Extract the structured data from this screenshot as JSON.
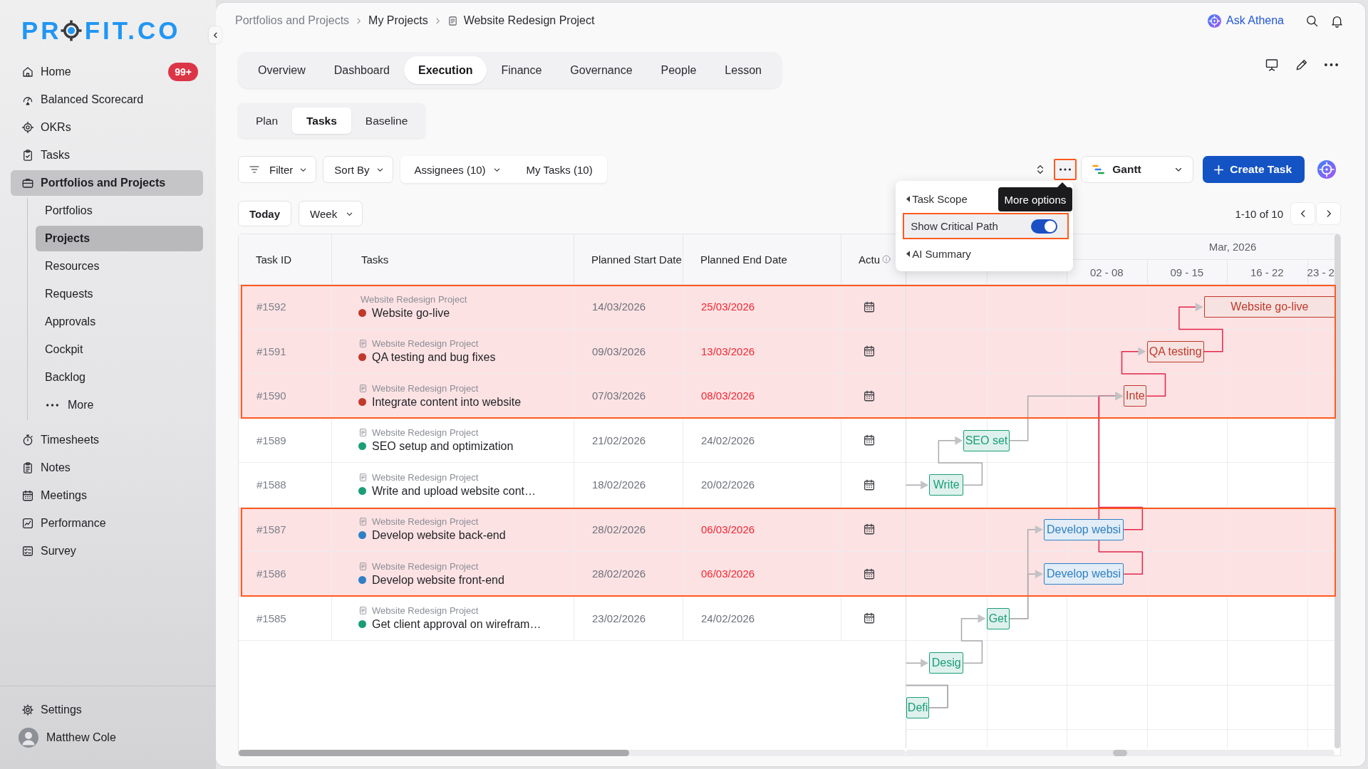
{
  "sidebar": {
    "logo": {
      "before": "PR",
      "after": "FIT.CO"
    },
    "items": [
      {
        "label": "Home",
        "badge": "99+",
        "selected": false
      },
      {
        "label": "Balanced Scorecard",
        "selected": false
      },
      {
        "label": "OKRs",
        "selected": false
      },
      {
        "label": "Tasks",
        "selected": false
      },
      {
        "label": "Portfolios and Projects",
        "selected": true,
        "children": [
          {
            "label": "Portfolios",
            "kind": "page",
            "selected": false
          },
          {
            "label": "Projects",
            "kind": "page",
            "selected": true
          },
          {
            "label": "Resources",
            "kind": "page",
            "selected": false
          },
          {
            "label": "Requests",
            "kind": "page",
            "selected": false
          },
          {
            "label": "Approvals",
            "kind": "page",
            "selected": false
          },
          {
            "label": "Cockpit",
            "kind": "page",
            "selected": false
          },
          {
            "label": "Backlog",
            "kind": "page",
            "selected": false
          },
          {
            "label": "More",
            "kind": "more",
            "selected": false
          }
        ]
      },
      {
        "label": "Timesheets",
        "selected": false
      },
      {
        "label": "Notes",
        "selected": false
      },
      {
        "label": "Meetings",
        "selected": false
      },
      {
        "label": "Performance",
        "selected": false
      },
      {
        "label": "Survey",
        "selected": false
      }
    ],
    "footer": [
      {
        "label": "Settings",
        "kind": "settings"
      },
      {
        "label": "Matthew Cole",
        "kind": "user"
      }
    ]
  },
  "header": {
    "breadcrumb": [
      {
        "label": "Portfolios and Projects",
        "muted": true
      },
      {
        "label": "My Projects",
        "muted": false
      },
      {
        "label": "Website Redesign Project",
        "muted": false
      }
    ],
    "assistant": "Ask Athena"
  },
  "tabs": [
    {
      "label": "Overview",
      "selected": false
    },
    {
      "label": "Dashboard",
      "selected": false
    },
    {
      "label": "Execution",
      "selected": true
    },
    {
      "label": "Finance",
      "selected": false
    },
    {
      "label": "Governance",
      "selected": false
    },
    {
      "label": "People",
      "selected": false
    },
    {
      "label": "Lesson",
      "selected": false
    }
  ],
  "subtabs": [
    {
      "label": "Plan",
      "selected": false
    },
    {
      "label": "Tasks",
      "selected": true
    },
    {
      "label": "Baseline",
      "selected": false
    }
  ],
  "toolbar": {
    "filters": [
      {
        "label": "Filter",
        "kind": "filter"
      },
      {
        "label": "Sort By",
        "kind": "menu"
      }
    ],
    "scope": [
      {
        "label": "Assignees (10)",
        "kind": "menu"
      },
      {
        "label": "My Tasks (10)",
        "kind": "plain"
      }
    ],
    "more_highlighted": true,
    "view": "Gantt",
    "create": "Create Task"
  },
  "more_menu": {
    "tooltip": "More options",
    "items": [
      {
        "label": "Task Scope",
        "kind": "submenu",
        "highlighted": false
      },
      {
        "label": "Show Critical Path",
        "kind": "toggle",
        "on": true,
        "highlighted": true
      },
      {
        "label": "AI Summary",
        "kind": "submenu",
        "highlighted": false
      }
    ]
  },
  "date_nav": {
    "today": "Today",
    "scale": "Week",
    "range": "1-10 of 10"
  },
  "table": {
    "columns": [
      "Task ID",
      "Tasks",
      "Planned Start Date",
      "Planned End Date",
      "Actu"
    ],
    "rows": [
      {
        "id": "#1592",
        "project": "Website Redesign Project",
        "project_icon": false,
        "name": "Website go-live",
        "color": "#c0392b",
        "start": "14/03/2026",
        "end": "25/03/2026",
        "overdue": true,
        "critical": true
      },
      {
        "id": "#1591",
        "project": "Website Redesign Project",
        "project_icon": true,
        "name": "QA testing and bug fixes",
        "color": "#c0392b",
        "start": "09/03/2026",
        "end": "13/03/2026",
        "overdue": true,
        "critical": true
      },
      {
        "id": "#1590",
        "project": "Website Redesign Project",
        "project_icon": true,
        "name": "Integrate content into website",
        "color": "#c0392b",
        "start": "07/03/2026",
        "end": "08/03/2026",
        "overdue": true,
        "critical": true
      },
      {
        "id": "#1589",
        "project": "Website Redesign Project",
        "project_icon": true,
        "name": "SEO setup and optimization",
        "color": "#1a9e78",
        "start": "21/02/2026",
        "end": "24/02/2026",
        "overdue": false,
        "critical": false
      },
      {
        "id": "#1588",
        "project": "Website Redesign Project",
        "project_icon": true,
        "name": "Write and upload website cont…",
        "color": "#1a9e78",
        "start": "18/02/2026",
        "end": "20/02/2026",
        "overdue": false,
        "critical": false
      },
      {
        "id": "#1587",
        "project": "Website Redesign Project",
        "project_icon": true,
        "name": "Develop website back-end",
        "color": "#2f80c4",
        "start": "28/02/2026",
        "end": "06/03/2026",
        "overdue": true,
        "critical": true
      },
      {
        "id": "#1586",
        "project": "Website Redesign Project",
        "project_icon": true,
        "name": "Develop website front-end",
        "color": "#2f80c4",
        "start": "28/02/2026",
        "end": "06/03/2026",
        "overdue": true,
        "critical": true
      },
      {
        "id": "#1585",
        "project": "Website Redesign Project",
        "project_icon": true,
        "name": "Get client approval on wirefram…",
        "color": "#1a9e78",
        "start": "23/02/2026",
        "end": "24/02/2026",
        "overdue": false,
        "critical": false
      }
    ]
  },
  "gantt": {
    "month": "Mar, 2026",
    "weeks": [
      "02 - 08",
      "09 - 15",
      "16 - 22",
      "23 - 2"
    ],
    "bars": [
      {
        "label": "Website go-live",
        "color": "#c0392b",
        "critical": true
      },
      {
        "label": "QA testing",
        "color": "#c0392b",
        "critical": true
      },
      {
        "label": "Inte",
        "color": "#c0392b",
        "critical": true
      },
      {
        "label": "SEO set",
        "color": "#1a9e78",
        "critical": false
      },
      {
        "label": "Write",
        "color": "#1a9e78",
        "critical": false
      },
      {
        "label": "Develop websi",
        "color": "#2f80c4",
        "critical": true
      },
      {
        "label": "Develop websi",
        "color": "#2f80c4",
        "critical": true
      },
      {
        "label": "Get",
        "color": "#1a9e78",
        "critical": false
      },
      {
        "label": "Desig",
        "color": "#1a9e78",
        "critical": false
      },
      {
        "label": "Defi",
        "color": "#1a9e78",
        "critical": false
      }
    ]
  }
}
